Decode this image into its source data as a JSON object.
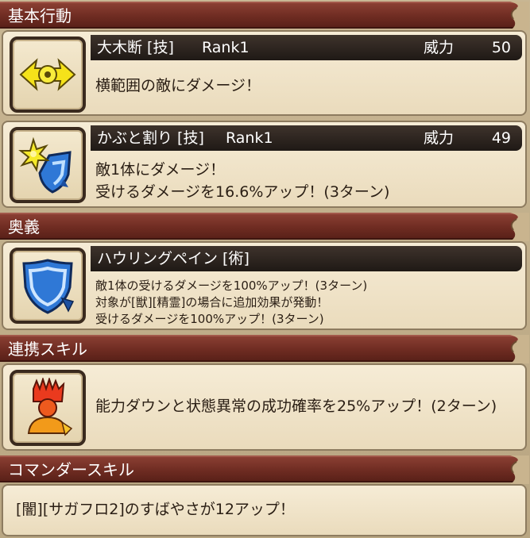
{
  "sections": {
    "basic": "基本行動",
    "ougi": "奥義",
    "renkei": "連携スキル",
    "commander": "コマンダースキル"
  },
  "skill1": {
    "name": "大木断 [技]",
    "rank": "Rank1",
    "power_label": "威力",
    "power": "50",
    "desc": "横範囲の敵にダメージ！",
    "icon": "slash-wave-icon"
  },
  "skill2": {
    "name": "かぶと割り [技]",
    "rank": "Rank1",
    "power_label": "威力",
    "power": "49",
    "desc1": "敵1体にダメージ！",
    "desc2": "受けるダメージを16.6%アップ！(3ターン)",
    "icon": "helm-break-icon"
  },
  "ougi": {
    "name": "ハウリングペイン [術]",
    "desc1": "敵1体の受けるダメージを100%アップ！(3ターン)",
    "desc2": "対象が[獣][精霊]の場合に追加効果が発動！",
    "desc3": "受けるダメージを100%アップ！(3ターン)",
    "icon": "shield-down-icon"
  },
  "renkei": {
    "desc": "能力ダウンと状態異常の成功確率を25%アップ！(2ターン)",
    "icon": "debuff-hand-icon"
  },
  "commander": {
    "desc": "[闇][サガフロ2]のすばやさが12アップ！"
  }
}
